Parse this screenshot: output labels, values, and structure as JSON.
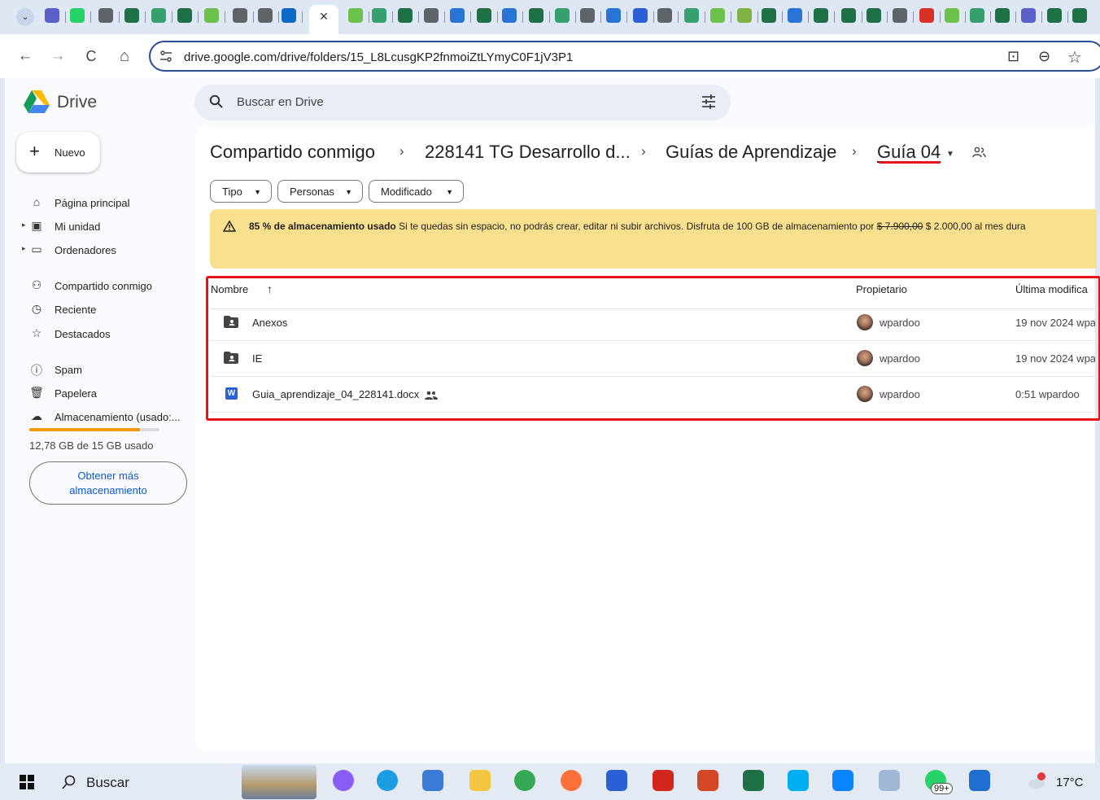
{
  "browser": {
    "active_tab_close": "×",
    "url": "drive.google.com/drive/folders/15_L8LcusgKP2fnmoiZtLYmyC0F1jV3P1",
    "nav": {
      "back": "←",
      "forward": "→",
      "reload": "C",
      "home": "⌂"
    },
    "right_icons": {
      "install": "⊡",
      "zoom": "⊖",
      "bookmark": "☆"
    }
  },
  "drive": {
    "logo_text": "Drive",
    "search_placeholder": "Buscar en Drive",
    "new_button": "Nuevo",
    "new_plus": "+",
    "sidebar": [
      {
        "label": "Página principal",
        "icon": "home-icon"
      },
      {
        "label": "Mi unidad",
        "icon": "drive-icon"
      },
      {
        "label": "Ordenadores",
        "icon": "computer-icon"
      },
      {
        "label": "Compartido conmigo",
        "icon": "shared-icon"
      },
      {
        "label": "Reciente",
        "icon": "clock-icon"
      },
      {
        "label": "Destacados",
        "icon": "star-icon"
      },
      {
        "label": "Spam",
        "icon": "spam-icon"
      },
      {
        "label": "Papelera",
        "icon": "trash-icon"
      },
      {
        "label": "Almacenamiento (usado:...",
        "icon": "cloud-icon"
      }
    ],
    "storage": {
      "used_text": "12,78 GB de 15 GB usado",
      "fraction": 0.85,
      "bar_color": "#f29900"
    },
    "get_more_storage": [
      "Obtener más",
      "almacenamiento"
    ],
    "breadcrumb": [
      "Compartido conmigo",
      "228141 TG Desarrollo d...",
      "Guías de Aprendizaje",
      "Guía 04"
    ],
    "breadcrumb_sep": "›",
    "filters": [
      "Tipo",
      "Personas",
      "Modificado"
    ],
    "banner": {
      "bold": "85 % de almacenamiento usado",
      "text": " Si te quedas sin espacio, no podrás crear, editar ni subir archivos. Disfruta de 100 GB de almacenamiento por ",
      "old_price": "$ 7.900,00",
      "new_price": " $ 2.000,00 al mes dura"
    },
    "table": {
      "headers": {
        "name": "Nombre",
        "sort": "↑",
        "owner": "Propietario",
        "modified": "Última modifica"
      },
      "rows": [
        {
          "name": "Anexos",
          "type": "shared-folder",
          "owner": "wpardoo",
          "modified": "19 nov 2024 wpa"
        },
        {
          "name": "IE",
          "type": "shared-folder",
          "owner": "wpardoo",
          "modified": "19 nov 2024 wpa"
        },
        {
          "name": "Guia_aprendizaje_04_228141.docx",
          "type": "word-doc",
          "owner": "wpardoo",
          "modified": "0:51 wpardoo"
        }
      ]
    },
    "highlight_color": "#e8101b"
  },
  "taskbar": {
    "search": "Buscar",
    "whatsapp_badge": "99+",
    "weather": "17°C"
  }
}
